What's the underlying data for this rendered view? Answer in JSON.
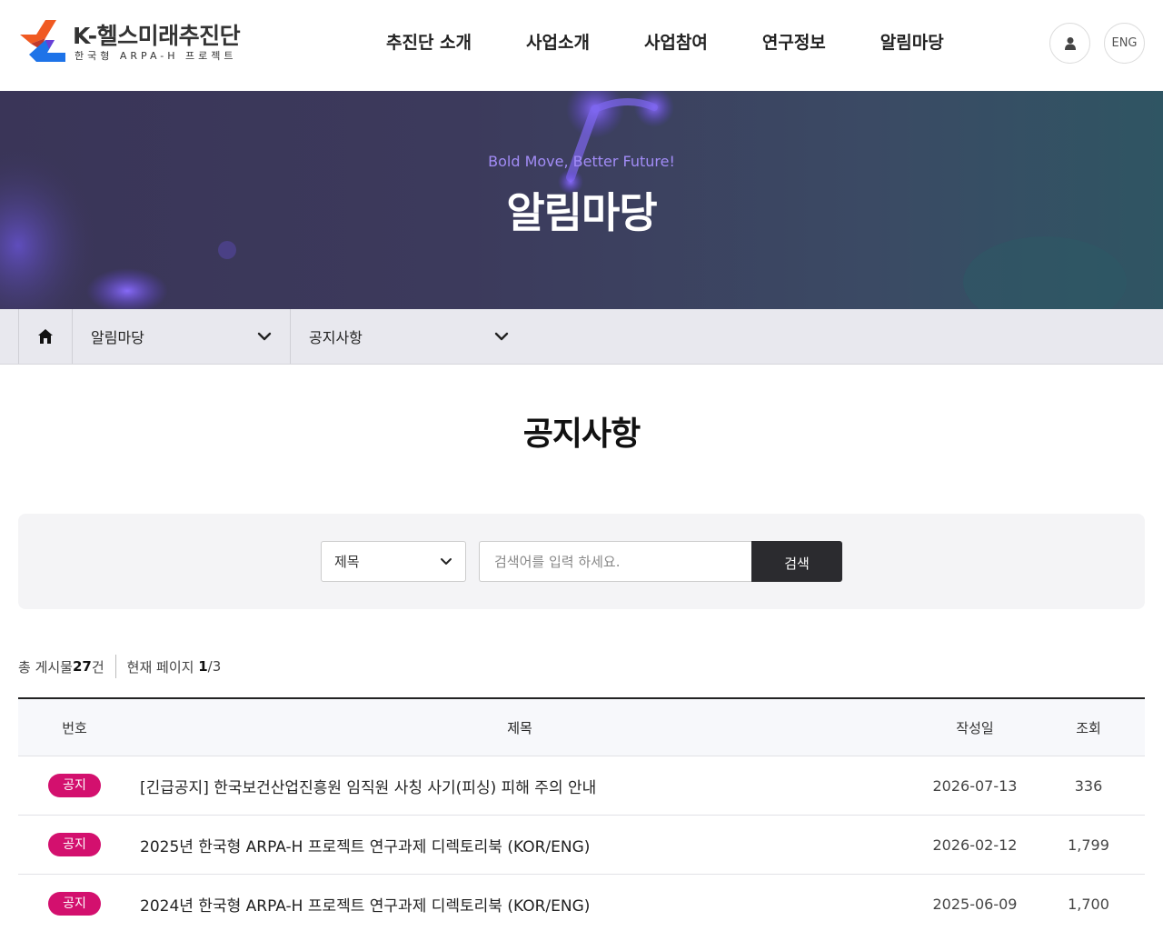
{
  "header": {
    "logo_title": "K-헬스미래추진단",
    "logo_subtitle": "한국형 ARPA-H 프로젝트",
    "nav": [
      "추진단 소개",
      "사업소개",
      "사업참여",
      "연구정보",
      "알림마당"
    ],
    "lang_button": "ENG"
  },
  "hero": {
    "subtitle": "Bold Move, Better Future!",
    "title": "알림마당"
  },
  "breadcrumb": {
    "depth1": "알림마당",
    "depth2": "공지사항"
  },
  "page_title": "공지사항",
  "search": {
    "select_value": "제목",
    "placeholder": "검색어를 입력 하세요.",
    "button_label": "검색"
  },
  "summary": {
    "total_prefix": "총 게시물",
    "total_count": "27",
    "total_suffix": "건",
    "page_prefix": "현재 페이지",
    "current_page": "1",
    "total_pages": "/3"
  },
  "table": {
    "columns": [
      "번호",
      "제목",
      "작성일",
      "조회"
    ],
    "rows": [
      {
        "badge": "공지",
        "title": "[긴급공지] 한국보건산업진흥원 임직원 사칭 사기(피싱) 피해 주의 안내",
        "date": "2026-07-13",
        "views": "336"
      },
      {
        "badge": "공지",
        "title": "2025년 한국형 ARPA-H 프로젝트 연구과제 디렉토리북 (KOR/ENG)",
        "date": "2026-02-12",
        "views": "1,799"
      },
      {
        "badge": "공지",
        "title": "2024년 한국형 ARPA-H 프로젝트 연구과제 디렉토리북 (KOR/ENG)",
        "date": "2025-06-09",
        "views": "1,700"
      }
    ]
  },
  "colors": {
    "badge": "#d3106e",
    "hero_subtitle": "#a28cf6",
    "search_button": "#2b2b2f",
    "logo_orange": "#f05a22",
    "logo_blue": "#1e73e8"
  }
}
